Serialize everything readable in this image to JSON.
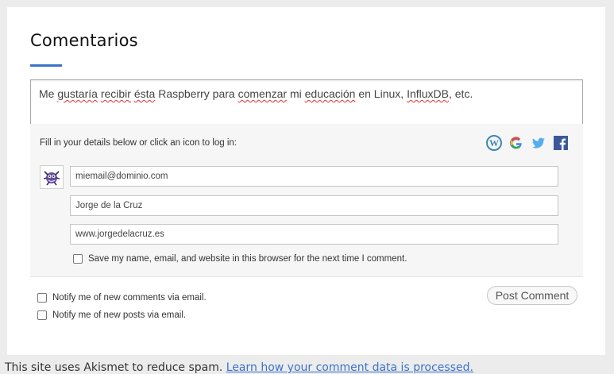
{
  "section": {
    "title": "Comentarios"
  },
  "comment": {
    "parts": [
      {
        "t": "Me ",
        "sq": false
      },
      {
        "t": "gustaría",
        "sq": true
      },
      {
        "t": " ",
        "sq": false
      },
      {
        "t": "recibir",
        "sq": true
      },
      {
        "t": " ",
        "sq": false
      },
      {
        "t": "ésta",
        "sq": true
      },
      {
        "t": " Raspberry para ",
        "sq": false
      },
      {
        "t": "comenzar",
        "sq": true
      },
      {
        "t": " mi ",
        "sq": false
      },
      {
        "t": "educación",
        "sq": true
      },
      {
        "t": " en Linux, ",
        "sq": false
      },
      {
        "t": "InfluxDB",
        "sq": true
      },
      {
        "t": ", etc.",
        "sq": false
      }
    ]
  },
  "login": {
    "hint": "Fill in your details below or click an icon to log in:",
    "icons": [
      "wordpress-icon",
      "google-icon",
      "twitter-icon",
      "facebook-icon"
    ]
  },
  "fields": {
    "email": "miemail@dominio.com",
    "name": "Jorge de la Cruz",
    "website": "www.jorgedelacruz.es"
  },
  "save_info": {
    "label": "Save my name, email, and website in this browser for the next time I comment.",
    "checked": false
  },
  "notify": {
    "comments": {
      "label": "Notify me of new comments via email.",
      "checked": false
    },
    "posts": {
      "label": "Notify me of new posts via email.",
      "checked": false
    }
  },
  "post_button": {
    "label": "Post Comment"
  },
  "footer": {
    "text": "This site uses Akismet to reduce spam. ",
    "link": "Learn how your comment data is processed."
  },
  "colors": {
    "accent": "#3b73c9",
    "wordpress": "#3d86b4",
    "twitter": "#55acee",
    "facebook": "#3b5998"
  }
}
